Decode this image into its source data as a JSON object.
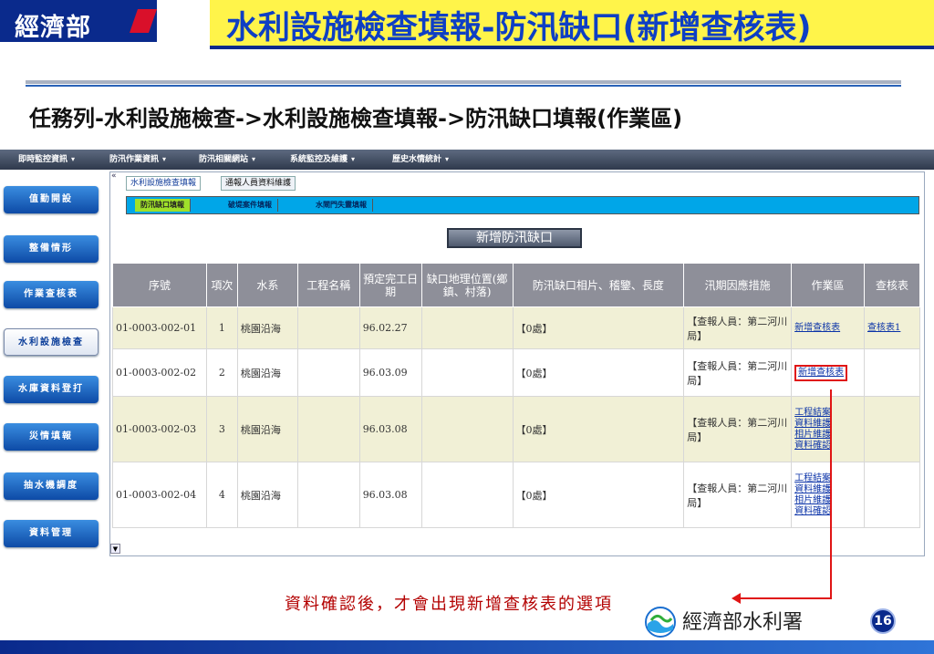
{
  "slide": {
    "logo_text": "經濟部",
    "title": "水利設施檢查填報-防汛缺口(新增查核表)",
    "breadcrumb": "任務列-水利設施檢查->水利設施檢查填報->防汛缺口填報(作業區)",
    "annotation": "資料確認後，才會出現新增查核表的選項",
    "footer_org": "經濟部水利署",
    "page_number": "16"
  },
  "menubar": {
    "items": [
      {
        "label": "即時監控資訊"
      },
      {
        "label": "防汛作業資訊"
      },
      {
        "label": "防汛相關網站"
      },
      {
        "label": "系統監控及維護"
      },
      {
        "label": "歷史水情統計"
      }
    ]
  },
  "sidebar": {
    "items": [
      {
        "label": "值勤開設"
      },
      {
        "label": "整備情形"
      },
      {
        "label": "作業查核表"
      },
      {
        "label": "水利設施檢查"
      },
      {
        "label": "水庫資料登打"
      },
      {
        "label": "災情填報"
      },
      {
        "label": "抽水機調度"
      },
      {
        "label": "資料管理"
      }
    ],
    "active_index": 3
  },
  "tabs": [
    {
      "label": "水利設施檢查填報"
    },
    {
      "label": "通報人員資料維護"
    }
  ],
  "subtabs": [
    {
      "label": "防汛缺口填報"
    },
    {
      "label": "破堤案件填報"
    },
    {
      "label": "水閘門失靈填報"
    }
  ],
  "add_button": "新增防汛缺口",
  "table": {
    "headers": [
      "序號",
      "項次",
      "水系",
      "工程名稱",
      "預定完工日期",
      "缺口地理位置(鄉鎮、村落)",
      "防汛缺口相片、稽鑒、長度",
      "汛期因應措施",
      "作業區",
      "查核表"
    ],
    "rows": [
      {
        "serial": "01-0003-002-01",
        "item": "1",
        "river": "桃園沿海",
        "project": "",
        "date": "96.02.27",
        "location": "",
        "gap": "【0處】",
        "measure": "【查報人員：第二河川局】",
        "actions": [
          "新增查核表"
        ],
        "audit": "查核表1"
      },
      {
        "serial": "01-0003-002-02",
        "item": "2",
        "river": "桃園沿海",
        "project": "",
        "date": "96.03.09",
        "location": "",
        "gap": "【0處】",
        "measure": "【查報人員：第二河川局】",
        "actions": [
          "新增查核表"
        ],
        "audit": ""
      },
      {
        "serial": "01-0003-002-03",
        "item": "3",
        "river": "桃園沿海",
        "project": "",
        "date": "96.03.08",
        "location": "",
        "gap": "【0處】",
        "measure": "【查報人員：第二河川局】",
        "actions": [
          "工程結案",
          "資料維護",
          "相片維護",
          "資料確認"
        ],
        "audit": ""
      },
      {
        "serial": "01-0003-002-04",
        "item": "4",
        "river": "桃園沿海",
        "project": "",
        "date": "96.03.08",
        "location": "",
        "gap": "【0處】",
        "measure": "【查報人員：第二河川局】",
        "actions": [
          "工程結案",
          "資料維護",
          "相片維護",
          "資料確認"
        ],
        "audit": ""
      }
    ]
  },
  "colors": {
    "title_blue": "#0e3fc4",
    "title_bg": "#fff44a",
    "navy": "#0a2a8c",
    "highlight_red": "#e01515",
    "subtab_active": "#9fe02a",
    "subtab_bar": "#00a6e8"
  }
}
